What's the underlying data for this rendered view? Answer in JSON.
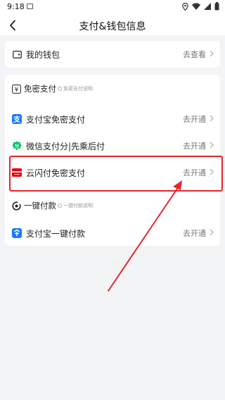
{
  "status_bar": {
    "time": "9:18"
  },
  "nav": {
    "title": "支付&钱包信息"
  },
  "wallet": {
    "label": "我的钱包",
    "action": "去查看"
  },
  "mianmi": {
    "title": "免密支付",
    "info": "免密支付说明",
    "items": [
      {
        "label": "支付宝免密支付",
        "action": "去开通",
        "icon": "alipay-icon"
      },
      {
        "label": "微信支付分|先乘后付",
        "action": "去开通",
        "icon": "wechat-score-icon"
      },
      {
        "label": "云闪付免密支付",
        "action": "去开通",
        "icon": "unionpay-icon"
      }
    ]
  },
  "yijian": {
    "title": "一键付款",
    "info": "一键付款说明",
    "items": [
      {
        "label": "支付宝一键付款",
        "action": "去开通",
        "icon": "alipay-quickpay-icon"
      }
    ]
  },
  "colors": {
    "highlight": "#e8252a",
    "alipay_blue": "#1677ff",
    "wechat_green": "#07c160",
    "unionpay_red": "#e60012"
  }
}
